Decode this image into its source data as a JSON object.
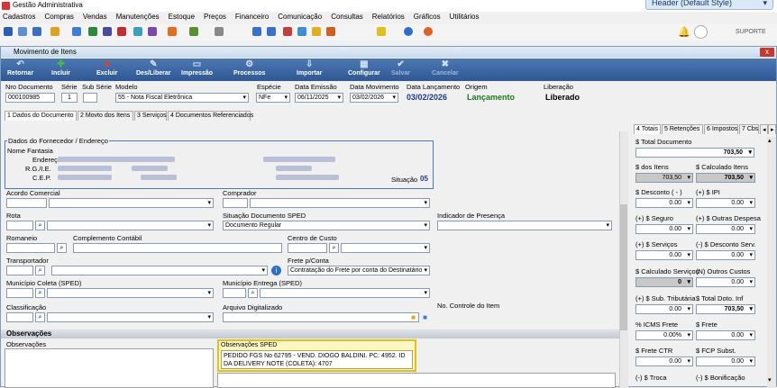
{
  "app": {
    "title": "Gestão Administrativa",
    "style_dropdown": "Header (Default Style)",
    "support": "SUPORTE"
  },
  "menu": [
    "Cadastros",
    "Compras",
    "Vendas",
    "Manutenções",
    "Estoque",
    "Preços",
    "Financeiro",
    "Comunicação",
    "Consultas",
    "Relatórios",
    "Gráficos",
    "Utilitários"
  ],
  "window": {
    "title": "Movimento de Itens",
    "close": "x"
  },
  "toolbar": [
    {
      "label": "Retornar",
      "icon": "return-icon",
      "enabled": true
    },
    {
      "label": "Incluir",
      "icon": "plus-icon",
      "enabled": true
    },
    {
      "label": "Excluir",
      "icon": "delete-icon",
      "enabled": true
    },
    {
      "label": "Des/Liberar",
      "icon": "release-icon",
      "enabled": true
    },
    {
      "label": "Impressão",
      "icon": "printer-icon",
      "enabled": true
    },
    {
      "label": "Processos",
      "icon": "process-icon",
      "enabled": true
    },
    {
      "label": "Importar",
      "icon": "import-icon",
      "enabled": true
    },
    {
      "label": "Configurar",
      "icon": "configure-icon",
      "enabled": true
    },
    {
      "label": "Salvar",
      "icon": "check-icon",
      "enabled": false
    },
    {
      "label": "Cancelar",
      "icon": "cancel-icon",
      "enabled": false
    }
  ],
  "header": {
    "nro_documento_label": "Nro Documento",
    "nro_documento": "000100985",
    "serie_label": "Série",
    "serie": "1",
    "sub_serie_label": "Sub Série",
    "sub_serie": "",
    "modelo_label": "Modelo",
    "modelo": "55 - Nota Fiscal Eletrônica",
    "especie_label": "Espécie",
    "especie": "NFe",
    "data_emissao_label": "Data Emissão",
    "data_emissao": "06/11/2025",
    "data_movimento_label": "Data Movimento",
    "data_movimento": "03/02/2026",
    "data_lancamento_label": "Data Lançamento",
    "data_lancamento": "03/02/2026",
    "origem_label": "Origem",
    "origem": "Lançamento",
    "liberacao_label": "Liberação",
    "liberacao": "Liberado"
  },
  "tabs": [
    "1 Dados do Documento",
    "2 Movto dos Itens",
    "3 Serviços",
    "4 Documentos Referenciados"
  ],
  "fornecedor": {
    "group_label": "Dados do Fornecedor / Endereço",
    "nome_fantasia_label": "Nome Fantasia",
    "endereco_label": "Endereço",
    "rg_ie_label": "R.G./I.E.",
    "cep_label": "C.E.P.",
    "situacao_label": "Situação",
    "situacao": "05"
  },
  "form": {
    "acordo_comercial": "Acordo Comercial",
    "comprador": "Comprador",
    "rota": "Rota",
    "situacao_sped": "Situação Documento SPED",
    "situacao_sped_value": "Documento Regular",
    "indicador_presenca": "Indicador de Presença",
    "romaneio": "Romaneio",
    "complemento_contabil": "Complemento Contábil",
    "centro_custo": "Centro de Custo",
    "transportador": "Transportador",
    "frete_conta": "Frete p/Conta",
    "frete_conta_value": "Contratação do Frete por conta do Destinatário",
    "municipio_coleta": "Município Coleta (SPED)",
    "municipio_entrega": "Município Entrega (SPED)",
    "classificacao": "Classificação",
    "arquivo_digitalizado": "Arquivo Digitalizado",
    "no_controle_item": "No. Controle do Item"
  },
  "observacoes": {
    "section": "Observações",
    "label": "Observações",
    "sped_label": "Observações SPED",
    "sped_text": "PEDIDO FGS No 62795 - VEND. DIOGO BALDINI. PC: 4952. ID DA DELIVERY NOTE (COLETA): 4707"
  },
  "right_tabs": [
    "4 Totais",
    "5 Retenções",
    "6 Impostos",
    "7 Cbs"
  ],
  "totais": {
    "total_documento_label": "$ Total Documento",
    "total_documento": "703,50",
    "dos_itens_label": "$ dos Itens",
    "dos_itens": "703,50",
    "calculado_itens_label": "$ Calculado Itens",
    "calculado_itens": "703,50",
    "desconto_label": "$ Desconto ( - )",
    "desconto": "0.00",
    "ipi_label": "(+) $ IPI",
    "ipi": "0.00",
    "seguro_label": "(+) $ Seguro",
    "seguro": "0.00",
    "outras_despesas_label": "(+) $ Outras Despesa",
    "outras_despesas": "0.00",
    "servicos_label": "(+) $ Serviços",
    "servicos": "0.00",
    "desconto_serv_label": "(-) $ Desconto Serv.",
    "desconto_serv": "0.00",
    "calculado_servicos_label": "$ Calculado Serviços",
    "calculado_servicos": "0",
    "outros_custos_label": "(N) Outros Custos",
    "outros_custos": "0.00",
    "sub_tributaria_label": "(+) $ Sub. Tributária",
    "sub_tributaria": "0.00",
    "total_doto_inf_label": "$ Total Doto. Inf",
    "total_doto_inf": "703,50",
    "icms_frete_label": "% ICMS Frete",
    "icms_frete": "0.00%",
    "frete_label": "$ Frete",
    "frete": "0.00",
    "frete_ctr_label": "$ Frete CTR",
    "frete_ctr": "0.00",
    "fcp_subst_label": "$ FCP Subst.",
    "fcp_subst": "0.00",
    "troca_label": "(-) $ Troca",
    "bonificacao_label": "(-) $ Bonificação"
  }
}
